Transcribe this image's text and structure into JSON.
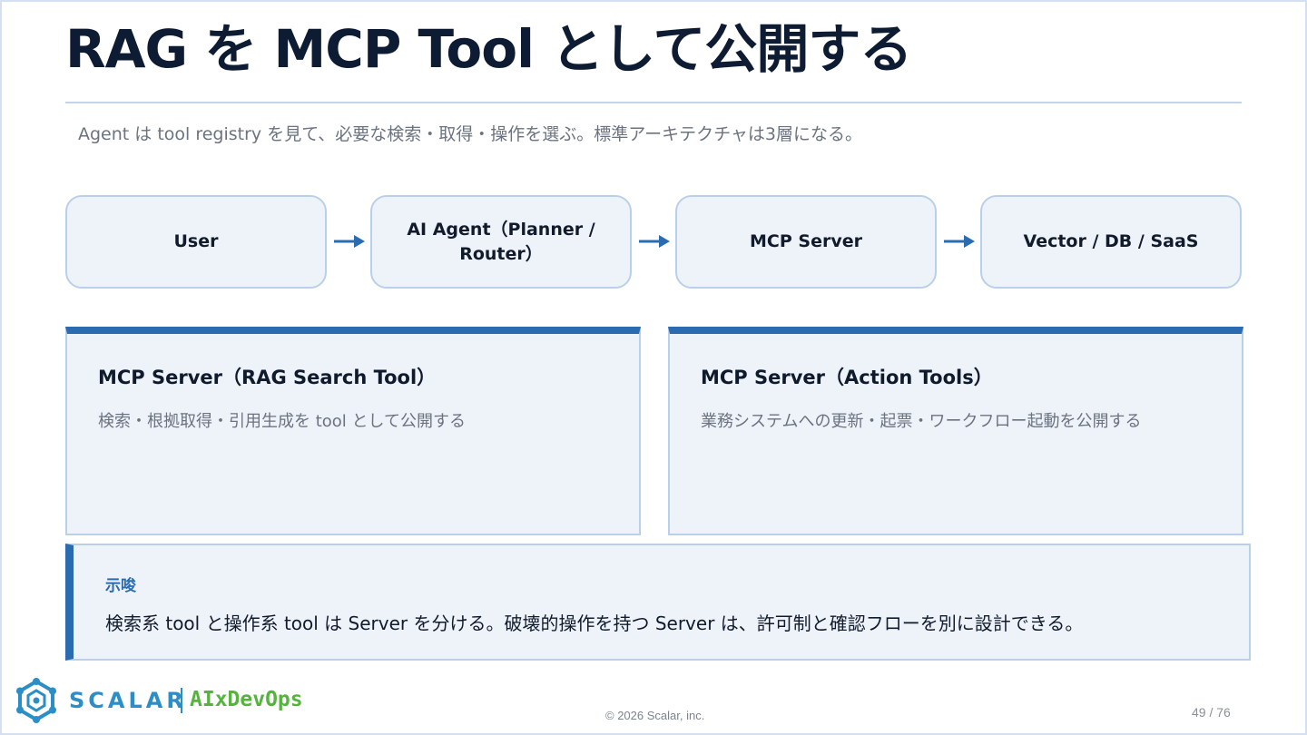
{
  "title": "RAG を MCP Tool として公開する",
  "subtitle": "Agent は tool registry を見て、必要な検索・取得・操作を選ぶ。標準アーキテクチャは3層になる。",
  "flow": {
    "nodes": [
      {
        "label": "User"
      },
      {
        "label": "AI Agent（Planner / Router）"
      },
      {
        "label": "MCP Server"
      },
      {
        "label": "Vector / DB / SaaS"
      }
    ],
    "arrow_icon": "right-arrow-icon",
    "arrow_color": "#2b6cb0"
  },
  "cards": [
    {
      "title": "MCP Server（RAG Search Tool）",
      "description": "検索・根拠取得・引用生成を tool として公開する"
    },
    {
      "title": "MCP Server（Action Tools）",
      "description": "業務システムへの更新・起票・ワークフロー起動を公開する"
    }
  ],
  "note": {
    "label": "示唆",
    "text": "検索系 tool と操作系 tool は Server を分ける。破壊的操作を持つ Server は、許可制と確認フローを別に設計できる。"
  },
  "footer": {
    "logo_icon": "scalar-logo-icon",
    "brand": "SCALAR",
    "product": "AIxDevOps",
    "copyright": "© 2026 Scalar, inc.",
    "page": "49 / 76"
  },
  "colors": {
    "accent": "#2b6cb0",
    "panel_bg": "#eef3fa",
    "panel_border": "#b9d0ea",
    "brand_blue": "#2c8ec7",
    "brand_green": "#56b33e"
  }
}
